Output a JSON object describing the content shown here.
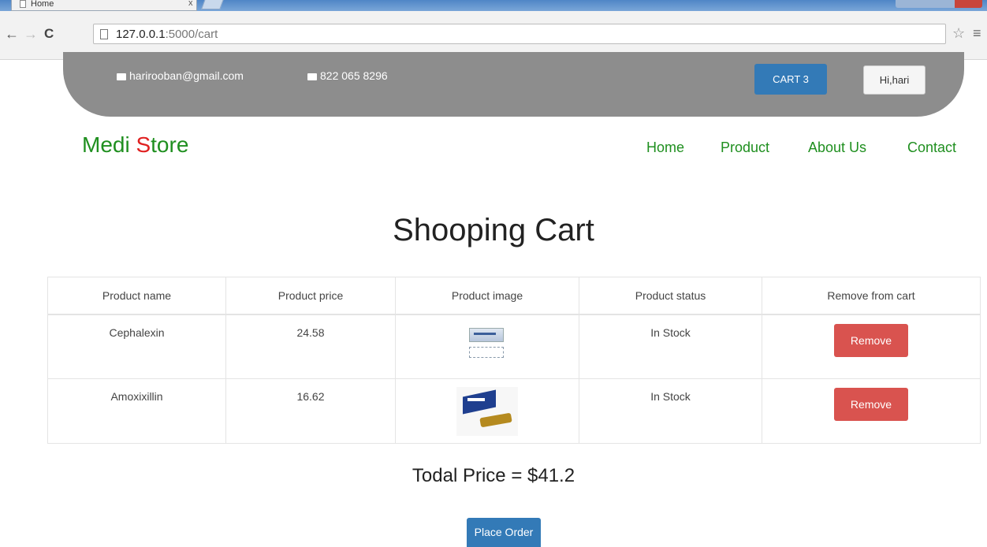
{
  "browser": {
    "tab_title": "Home",
    "tab_close": "x",
    "url_host": "127.0.0.1",
    "url_rest": ":5000/cart",
    "icons": [
      "back-arrow-icon",
      "forward-arrow-icon",
      "reload-icon",
      "page-icon",
      "star-icon",
      "menu-icon"
    ]
  },
  "topbar": {
    "email": "harirooban@gmail.com",
    "phone": "822 065 8296",
    "cart_label": "CART 3",
    "user_label": "Hi,hari"
  },
  "navbar": {
    "brand_main": "Medi ",
    "brand_s": "S",
    "brand_rest": "tore",
    "links": [
      "Home",
      "Product",
      "About Us",
      "Contact"
    ]
  },
  "cart": {
    "title": "Shooping Cart",
    "headers": [
      "Product name",
      "Product price",
      "Product image",
      "Product status",
      "Remove from cart"
    ],
    "rows": [
      {
        "name": "Cephalexin",
        "price": "24.58",
        "status": "In Stock",
        "remove": "Remove"
      },
      {
        "name": "Amoxixillin",
        "price": "16.62",
        "status": "In Stock",
        "remove": "Remove"
      }
    ],
    "total": "Todal Price = $41.2",
    "order_button": "Place Order"
  },
  "colors": {
    "brand_green": "#1f8f1f",
    "brand_red": "#e02020",
    "primary_blue": "#337ab7",
    "danger_red": "#d9534f",
    "topbar_gray": "#8d8d8d"
  }
}
